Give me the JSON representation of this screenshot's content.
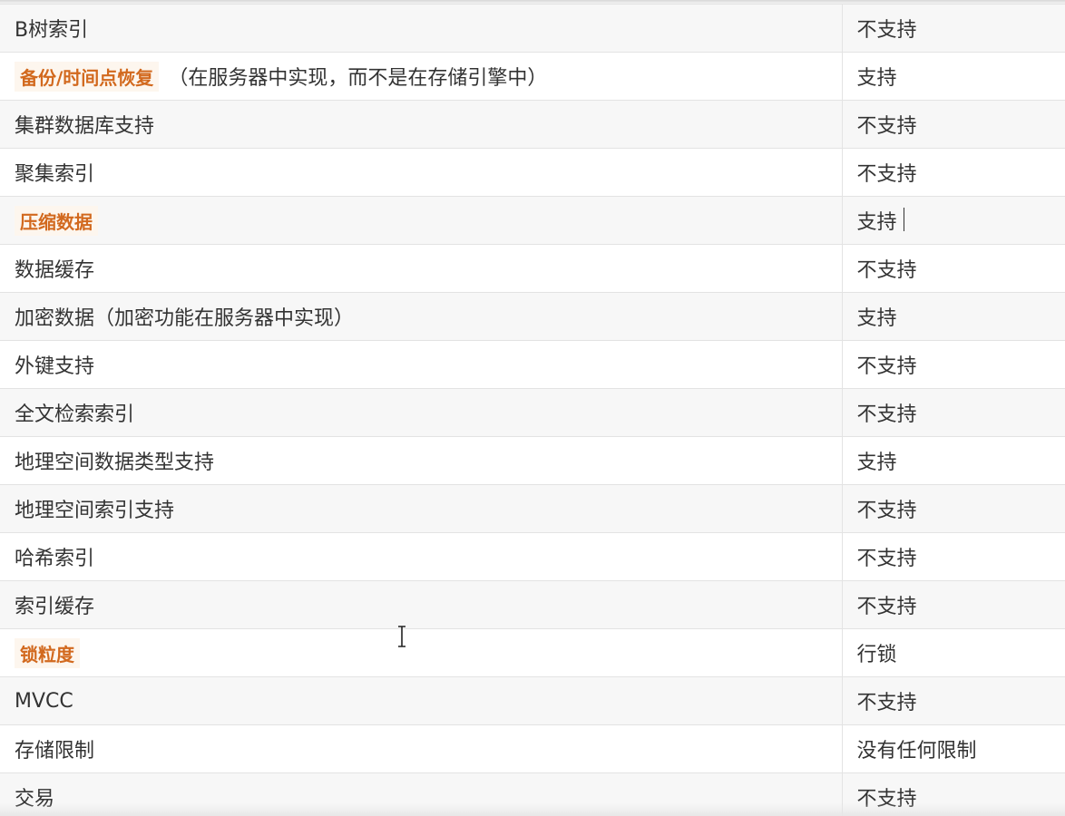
{
  "rows": [
    {
      "feature": "B树索引",
      "value": "不支持"
    },
    {
      "feature": "备份/时间点恢复",
      "note": "（在服务器中实现，而不是在存储引擎中）",
      "value": "支持"
    },
    {
      "feature": "集群数据库支持",
      "value": "不支持"
    },
    {
      "feature": "聚集索引",
      "value": "不支持"
    },
    {
      "feature": "压缩数据",
      "value": "支持"
    },
    {
      "feature": "数据缓存",
      "value": "不支持"
    },
    {
      "feature": "加密数据（加密功能在服务器中实现）",
      "value": "支持"
    },
    {
      "feature": "外键支持",
      "value": "不支持"
    },
    {
      "feature": "全文检索索引",
      "value": "不支持"
    },
    {
      "feature": "地理空间数据类型支持",
      "value": "支持"
    },
    {
      "feature": "地理空间索引支持",
      "value": "不支持"
    },
    {
      "feature": "哈希索引",
      "value": "不支持"
    },
    {
      "feature": "索引缓存",
      "value": "不支持"
    },
    {
      "feature": "锁粒度",
      "value": "行锁"
    },
    {
      "feature": "MVCC",
      "value": "不支持"
    },
    {
      "feature": "存储限制",
      "value": "没有任何限制"
    },
    {
      "feature": "交易",
      "value": "不支持"
    }
  ],
  "colors": {
    "highlight": "#d2691e",
    "text": "#333333",
    "border": "#e3e3e3",
    "row_alt": "#f7f7f7"
  },
  "icons": {
    "cursor": "i-beam-cursor-icon"
  }
}
